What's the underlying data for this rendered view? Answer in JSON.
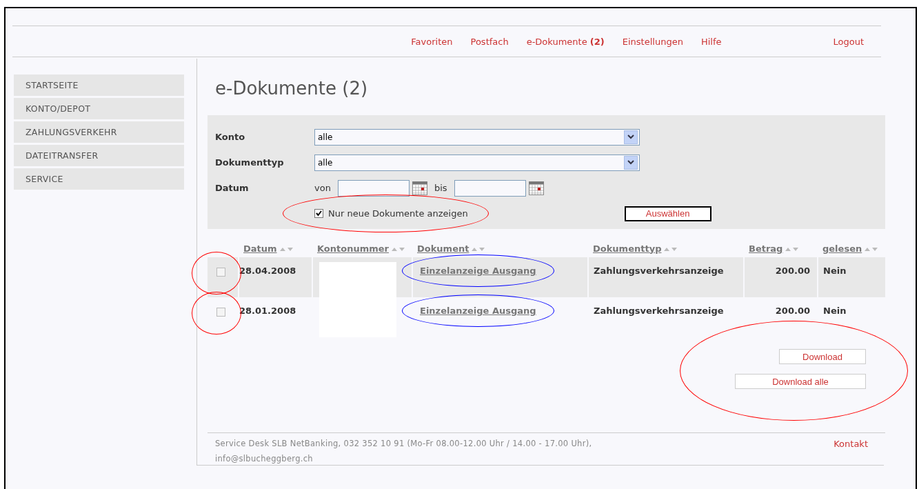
{
  "nav": {
    "items": [
      {
        "label": "Favoriten"
      },
      {
        "label": "Postfach"
      },
      {
        "label": "e-Dokumente",
        "count": "(2)"
      },
      {
        "label": "Einstellungen"
      },
      {
        "label": "Hilfe"
      }
    ],
    "logout": "Logout"
  },
  "sidebar": {
    "items": [
      {
        "label": "STARTSEITE"
      },
      {
        "label": "KONTO/DEPOT"
      },
      {
        "label": "ZAHLUNGSVERKEHR"
      },
      {
        "label": "DATEITRANSFER"
      },
      {
        "label": "SERVICE"
      }
    ]
  },
  "page_title": "e-Dokumente (2)",
  "filters": {
    "konto": {
      "label": "Konto",
      "value": "alle"
    },
    "dokumenttyp": {
      "label": "Dokumenttyp",
      "value": "alle"
    },
    "datum": {
      "label": "Datum",
      "from_label": "von",
      "to_label": "bis"
    },
    "new_only": {
      "label": "Nur neue Dokumente anzeigen",
      "checked": true,
      "annotation": {
        "color": "#ff0000"
      }
    },
    "submit": "Auswählen"
  },
  "table": {
    "columns": [
      "Datum",
      "Kontonummer",
      "Dokument",
      "Dokumenttyp",
      "Betrag",
      "gelesen"
    ],
    "rows": [
      {
        "checked": false,
        "checkbox_annotation": {
          "color": "#ff0000"
        },
        "datum": "28.04.2008",
        "dokument": "Einzelanzeige Ausgang",
        "dokument_annotation": {
          "color": "#0000ff"
        },
        "dokumenttyp": "Zahlungsverkehrsanzeige",
        "betrag": "200.00",
        "gelesen": "Nein"
      },
      {
        "checked": false,
        "checkbox_annotation": {
          "color": "#ff0000"
        },
        "datum": "28.01.2008",
        "dokument": "Einzelanzeige Ausgang",
        "dokument_annotation": {
          "color": "#0000ff"
        },
        "dokumenttyp": "Zahlungsverkehrsanzeige",
        "betrag": "200.00",
        "gelesen": "Nein"
      }
    ]
  },
  "actions": {
    "buttons": [
      "Download",
      "Download alle"
    ],
    "annotation": {
      "color": "#ff0000"
    }
  },
  "footer": {
    "text": "Service Desk SLB NetBanking, 032 352 10 91 (Mo-Fr 08.00-12.00 Uhr / 14.00 - 17.00 Uhr), info@slbucheggberg.ch",
    "link": "Kontakt"
  }
}
